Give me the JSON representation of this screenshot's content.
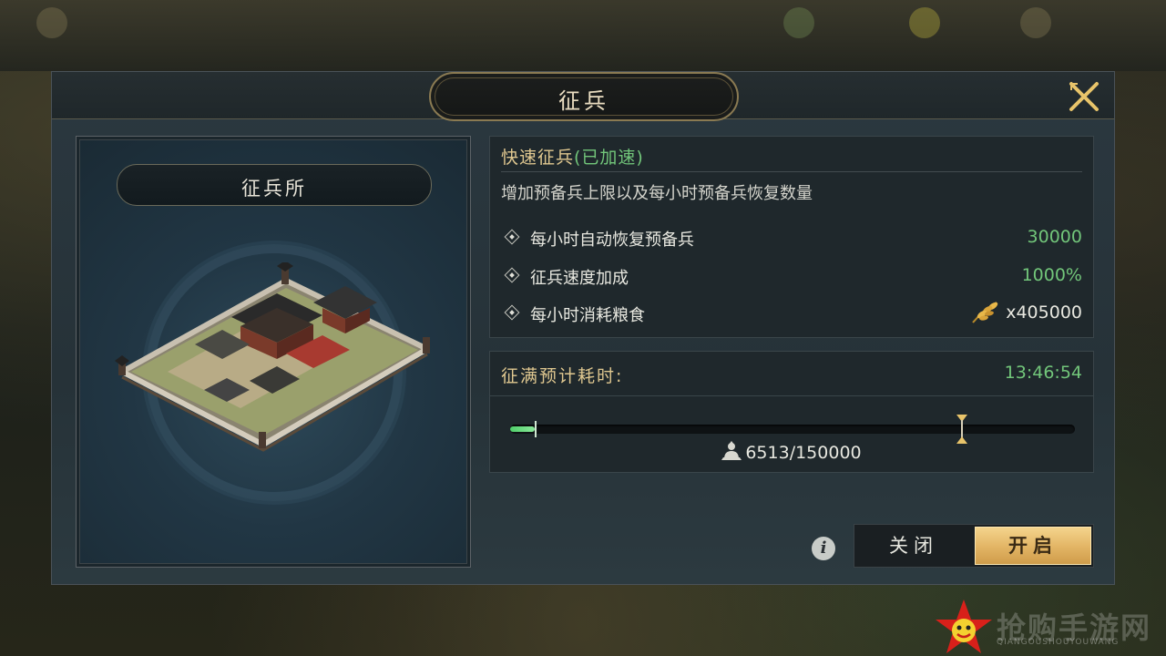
{
  "dialog": {
    "title": "征兵"
  },
  "building": {
    "name": "征兵所"
  },
  "speed": {
    "title": "快速征兵",
    "status": "(已加速)",
    "description": "增加预备兵上限以及每小时预备兵恢复数量"
  },
  "stats": [
    {
      "label": "每小时自动恢复预备兵",
      "value": "30000"
    },
    {
      "label": "征兵速度加成",
      "value": "1000%"
    },
    {
      "label": "每小时消耗粮食",
      "value": "x405000",
      "icon": "grain-icon"
    }
  ],
  "recruit": {
    "time_label": "征满预计耗时:",
    "time_value": "13:46:54",
    "count_text": "6513/150000",
    "current": 6513,
    "max": 150000,
    "marker_fraction": 0.8
  },
  "buttons": {
    "close_label": "关闭",
    "open_label": "开启"
  },
  "watermark": {
    "text": "抢购手游网",
    "sub": "QIANGOUSHOUYOUWANG"
  },
  "colors": {
    "accent_gold": "#e0c890",
    "value_green": "#72c67a",
    "button_gold": "#e2b464"
  }
}
